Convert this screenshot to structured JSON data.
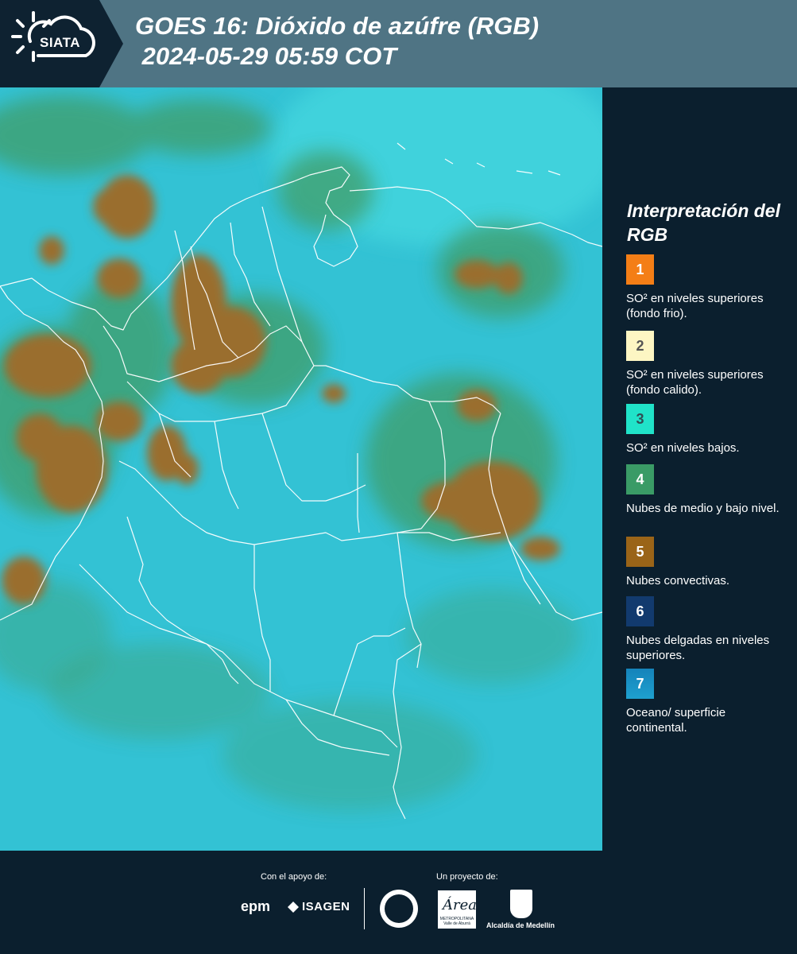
{
  "header": {
    "logo": "SIATA",
    "title": "GOES 16: Dióxido de azúfre (RGB)\n 2024-05-29 05:59 COT"
  },
  "legend": {
    "title": "Interpretación del RGB",
    "items": [
      {
        "number": "1",
        "color": "#f47e16",
        "text_color": "#ffffff",
        "description": "SO² en niveles superiores (fondo frio)."
      },
      {
        "number": "2",
        "color": "#fdf6c3",
        "text_color": "#555555",
        "description": "SO² en niveles superiores (fondo calido)."
      },
      {
        "number": "3",
        "color": "#20e3c9",
        "text_color": "#2f4f55",
        "description": "SO² en niveles bajos."
      },
      {
        "number": "4",
        "color": "#3a9b66",
        "text_color": "#ffffff",
        "description": "Nubes de medio y bajo nivel."
      },
      {
        "number": "5",
        "color": "#9a6418",
        "text_color": "#ffffff",
        "description": "Nubes convectivas."
      },
      {
        "number": "6",
        "color": "#123a6e",
        "text_color": "#ffffff",
        "description": "Nubes delgadas en niveles superiores."
      },
      {
        "number": "7",
        "color": "#1690c4",
        "text_color": "#ffffff",
        "description": "Oceano/ superficie continental."
      }
    ]
  },
  "footer": {
    "support_label": "Con el apoyo de:",
    "project_label": "Un proyecto de:",
    "sponsors": [
      "epm",
      "ISAGEN"
    ],
    "partners": [
      "Área Metropolitana Valle de Aburrá",
      "Alcaldía de Medellín"
    ],
    "area_logo_text": "Área",
    "area_logo_sub": "METROPOLITANA Valle de Aburrá",
    "alcaldia": "Alcaldía de Medellín"
  },
  "map": {
    "ocean_color": "#33c2d4",
    "convective_color": "#9a6e2e",
    "mid_cloud_color": "#3f9d69",
    "border_color": "#ffffff"
  }
}
